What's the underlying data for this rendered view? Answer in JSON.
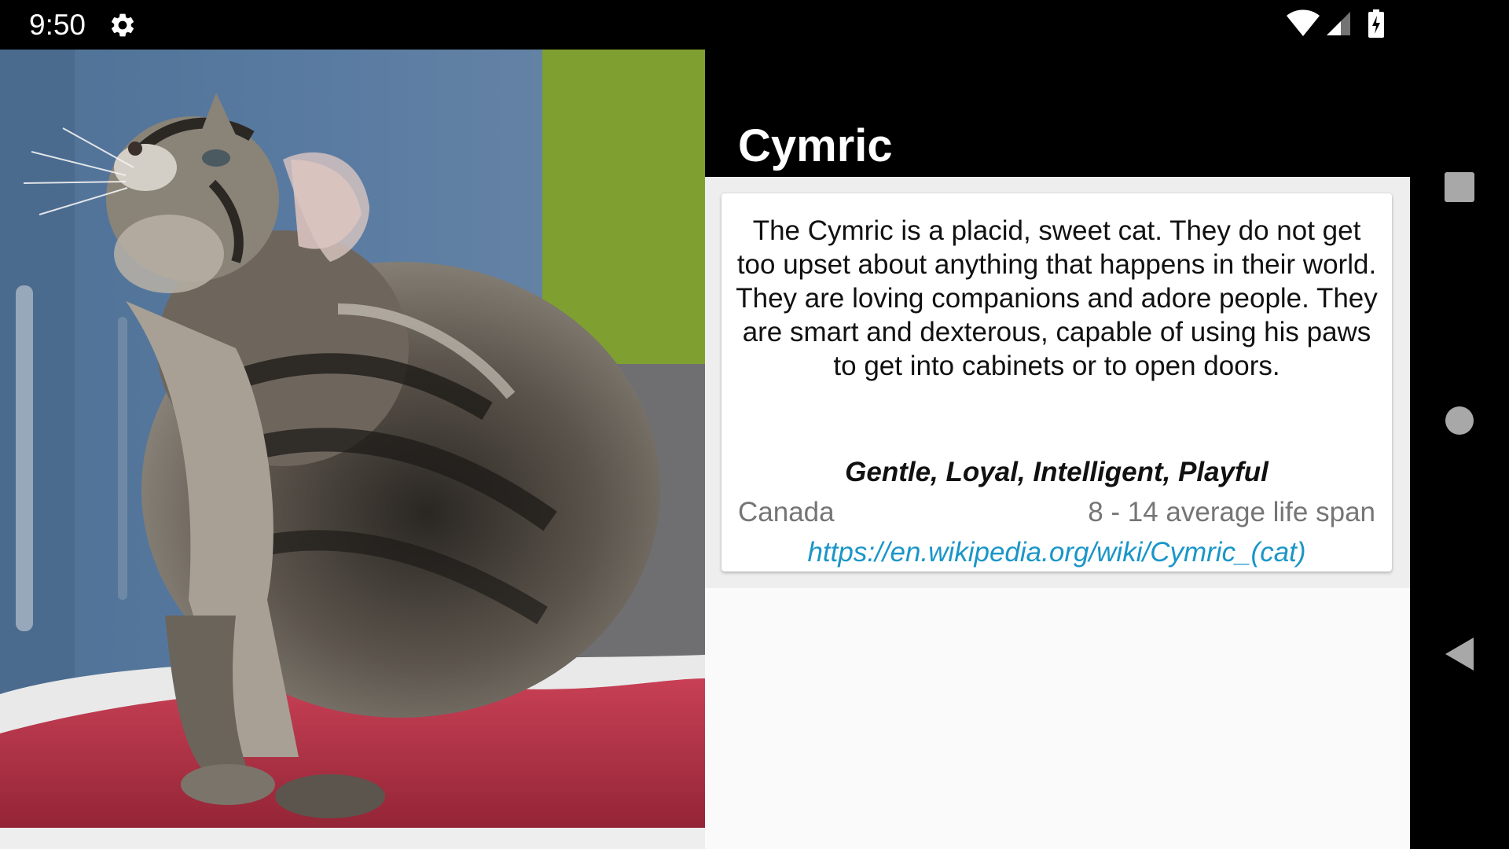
{
  "status_bar": {
    "time": "9:50",
    "icons": [
      "settings-gear-icon",
      "wifi-icon",
      "cellular-signal-icon",
      "battery-charging-icon"
    ]
  },
  "app_bar": {
    "title": "Cymric"
  },
  "breed_card": {
    "description": "The Cymric is a placid, sweet cat. They do not get too upset about anything that happens in their world. They are loving companions and adore people. They are smart and dexterous, capable of using his paws to get into cabinets or to open doors.",
    "temperament": "Gentle, Loyal, Intelligent, Playful",
    "origin": "Canada",
    "life_span": "8 - 14 average life span",
    "wikipedia_url": "https://en.wikipedia.org/wiki/Cymric_(cat)"
  },
  "navigation": {
    "buttons": [
      "recents-square-icon",
      "home-circle-icon",
      "back-triangle-icon"
    ]
  },
  "colors": {
    "status_bar": "#000000",
    "app_bar": "#000000",
    "content_background": "#fafafa",
    "card_background": "#ffffff",
    "secondary_text": "#757575",
    "link": "#1a96c8"
  }
}
